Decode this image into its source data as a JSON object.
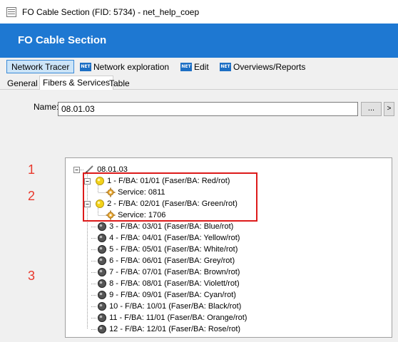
{
  "window": {
    "title": "FO Cable Section (FID: 5734) - net_help_coep"
  },
  "header": {
    "title": "FO Cable Section"
  },
  "toolbar": {
    "items": [
      {
        "label": "Network Tracer",
        "icon": "none"
      },
      {
        "label": "Network exploration",
        "icon": "net-icon"
      },
      {
        "label": "Edit",
        "icon": "net-icon"
      },
      {
        "label": "Overviews/Reports",
        "icon": "net-icon"
      }
    ],
    "badge_text": "NET"
  },
  "tabs": [
    {
      "label": "General"
    },
    {
      "label": "Fibers & Services",
      "active": true
    },
    {
      "label": "Table"
    }
  ],
  "form": {
    "name_label": "Name:",
    "name_value": "08.01.03",
    "browse_label": "...",
    "arrow_label": ">"
  },
  "tree": {
    "root": "08.01.03",
    "nodes": [
      {
        "label": "1 - F/BA: 01/01 (Faser/BA: Red/rot)",
        "status": "active",
        "expanded": true,
        "service": "Service: 0811"
      },
      {
        "label": "2 - F/BA: 02/01 (Faser/BA: Green/rot)",
        "status": "active",
        "expanded": true,
        "service": "Service: 1706"
      },
      {
        "label": "3 - F/BA: 03/01 (Faser/BA: Blue/rot)",
        "status": "inactive"
      },
      {
        "label": "4 - F/BA: 04/01 (Faser/BA: Yellow/rot)",
        "status": "inactive"
      },
      {
        "label": "5 - F/BA: 05/01 (Faser/BA: White/rot)",
        "status": "inactive"
      },
      {
        "label": "6 - F/BA: 06/01 (Faser/BA: Grey/rot)",
        "status": "inactive"
      },
      {
        "label": "7 - F/BA: 07/01 (Faser/BA: Brown/rot)",
        "status": "inactive"
      },
      {
        "label": "8 - F/BA: 08/01 (Faser/BA: Violett/rot)",
        "status": "inactive"
      },
      {
        "label": "9 - F/BA: 09/01 (Faser/BA: Cyan/rot)",
        "status": "inactive"
      },
      {
        "label": "10 - F/BA: 10/01 (Faser/BA: Black/rot)",
        "status": "inactive"
      },
      {
        "label": "11 - F/BA: 11/01 (Faser/BA: Orange/rot)",
        "status": "inactive"
      },
      {
        "label": "12 - F/BA: 12/01 (Faser/BA: Rose/rot)",
        "status": "inactive"
      }
    ]
  },
  "annotations": {
    "marker_1": "1",
    "marker_2": "2",
    "marker_3": "3"
  },
  "colors": {
    "header": "#1e78d2",
    "annotation": "#e8382c",
    "highlight": "#dd1a1a",
    "active_fiber": "#f3d21a",
    "inactive_fiber": "#555555"
  }
}
